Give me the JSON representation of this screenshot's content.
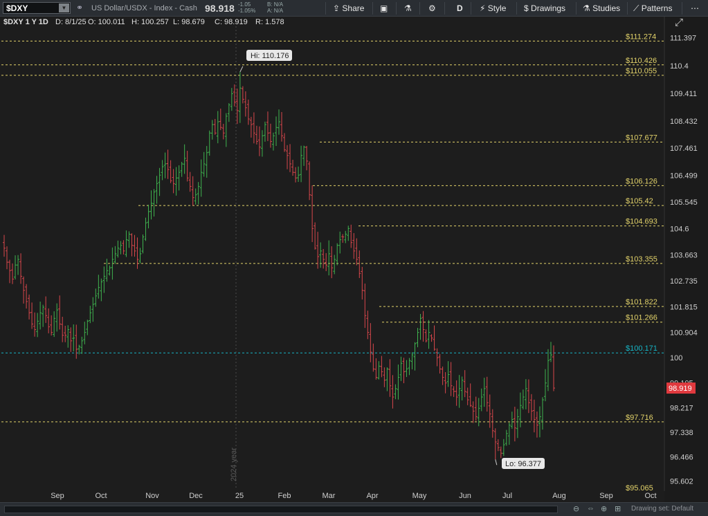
{
  "toolbar": {
    "symbol": "$DXY",
    "description": "US Dollar/USDX - Index - Cash",
    "last": "98.918",
    "change": "-1.05",
    "change_pct": "-1.05%",
    "bid": "B: N/A",
    "ask": "A: N/A",
    "share": "Share",
    "period": "D",
    "style": "Style",
    "drawings": "Drawings",
    "studies": "Studies",
    "patterns": "Patterns"
  },
  "infobar": {
    "label": "$DXY 1 Y 1D",
    "date": "D: 8/1/25",
    "open": "O: 100.011",
    "high": "H: 100.257",
    "low": "L: 98.679",
    "close": "C: 98.919",
    "range": "R: 1.578"
  },
  "status": {
    "drawing_set": "Drawing set: Default"
  },
  "colors": {
    "up": "#3fb34f",
    "down": "#d9474c",
    "level_line": "#e3d36a",
    "cyan_line": "#16b6c7",
    "price_tag": "#e0393e"
  },
  "chart_data": {
    "type": "ohlc",
    "y_ticks": [
      111.397,
      110.4,
      109.411,
      108.432,
      107.461,
      106.499,
      105.545,
      104.6,
      103.663,
      102.735,
      101.815,
      100.904,
      100,
      99.105,
      98.217,
      97.338,
      96.466,
      95.602
    ],
    "ylim": [
      95.3,
      111.8
    ],
    "x_labels": [
      "Sep",
      "Oct",
      "Nov",
      "Dec",
      "25",
      "Feb",
      "Mar",
      "Apr",
      "May",
      "Jun",
      "Jul",
      "Aug",
      "Sep",
      "Oct"
    ],
    "year_marker": "2024 year",
    "hi_label": "Hi: 110.176",
    "lo_label": "Lo: 96.377",
    "last_price": "98.919",
    "levels": [
      {
        "value": 111.274,
        "label": "$111.274"
      },
      {
        "value": 110.426,
        "label": "$110.426"
      },
      {
        "value": 110.055,
        "label": "$110.055"
      },
      {
        "value": 107.677,
        "label": "$107.677"
      },
      {
        "value": 106.126,
        "label": "$106.126"
      },
      {
        "value": 105.42,
        "label": "$105.42"
      },
      {
        "value": 104.693,
        "label": "$104.693"
      },
      {
        "value": 103.355,
        "label": "$103.355"
      },
      {
        "value": 101.822,
        "label": "$101.822"
      },
      {
        "value": 101.266,
        "label": "$101.266"
      },
      {
        "value": 100.171,
        "label": "$100.171"
      },
      {
        "value": 97.716,
        "label": "$97.716"
      },
      {
        "value": 95.065,
        "label": "$95.065"
      }
    ],
    "closes": [
      103.9,
      103.4,
      103.1,
      102.8,
      103.3,
      103.5,
      102.9,
      102.4,
      102.0,
      101.6,
      101.2,
      101.0,
      101.3,
      101.6,
      101.8,
      101.5,
      101.1,
      100.9,
      101.4,
      101.7,
      101.2,
      100.8,
      100.8,
      101.0,
      100.6,
      100.7,
      100.3,
      100.4,
      100.6,
      100.9,
      101.3,
      101.6,
      101.9,
      102.2,
      102.5,
      102.7,
      102.9,
      103.1,
      103.2,
      103.5,
      103.7,
      103.9,
      104.0,
      103.8,
      104.2,
      104.4,
      104.0,
      103.8,
      103.5,
      103.7,
      104.3,
      104.8,
      105.2,
      105.5,
      105.9,
      106.2,
      106.5,
      106.8,
      106.9,
      106.7,
      106.3,
      106.2,
      106.4,
      106.6,
      106.9,
      107.1,
      106.4,
      106.1,
      105.7,
      105.8,
      106.1,
      106.6,
      106.9,
      107.3,
      108.0,
      108.3,
      108.0,
      108.4,
      108.2,
      108.0,
      108.6,
      109.0,
      109.4,
      109.1,
      108.8,
      109.6,
      109.2,
      108.9,
      108.5,
      108.3,
      108.0,
      107.7,
      107.5,
      107.9,
      108.3,
      108.0,
      107.7,
      107.9,
      108.2,
      108.4,
      107.9,
      107.4,
      107.2,
      106.9,
      106.6,
      106.4,
      106.5,
      107.2,
      107.5,
      107.0,
      105.8,
      104.6,
      103.9,
      103.6,
      103.8,
      103.5,
      103.3,
      103.7,
      103.2,
      103.5,
      104.0,
      104.2,
      104.3,
      104.4,
      104.6,
      104.1,
      103.8,
      103.5,
      103.0,
      102.4,
      101.5,
      100.9,
      100.2,
      99.6,
      99.3,
      99.7,
      99.5,
      99.2,
      99.6,
      99.0,
      98.6,
      98.9,
      99.3,
      99.8,
      99.5,
      99.6,
      99.9,
      100.1,
      100.5,
      100.9,
      101.4,
      101.0,
      100.6,
      100.9,
      100.7,
      100.3,
      100.0,
      99.6,
      99.3,
      99.1,
      99.4,
      99.0,
      98.8,
      98.6,
      98.9,
      99.2,
      98.8,
      98.5,
      98.3,
      98.1,
      97.9,
      98.2,
      98.6,
      98.9,
      98.4,
      98.0,
      97.4,
      97.0,
      96.8,
      96.6,
      96.9,
      97.3,
      97.6,
      97.8,
      97.5,
      97.9,
      98.3,
      98.6,
      98.9,
      98.4,
      98.1,
      97.8,
      97.6,
      97.9,
      98.5,
      99.1,
      99.9,
      100.1,
      98.919
    ]
  }
}
